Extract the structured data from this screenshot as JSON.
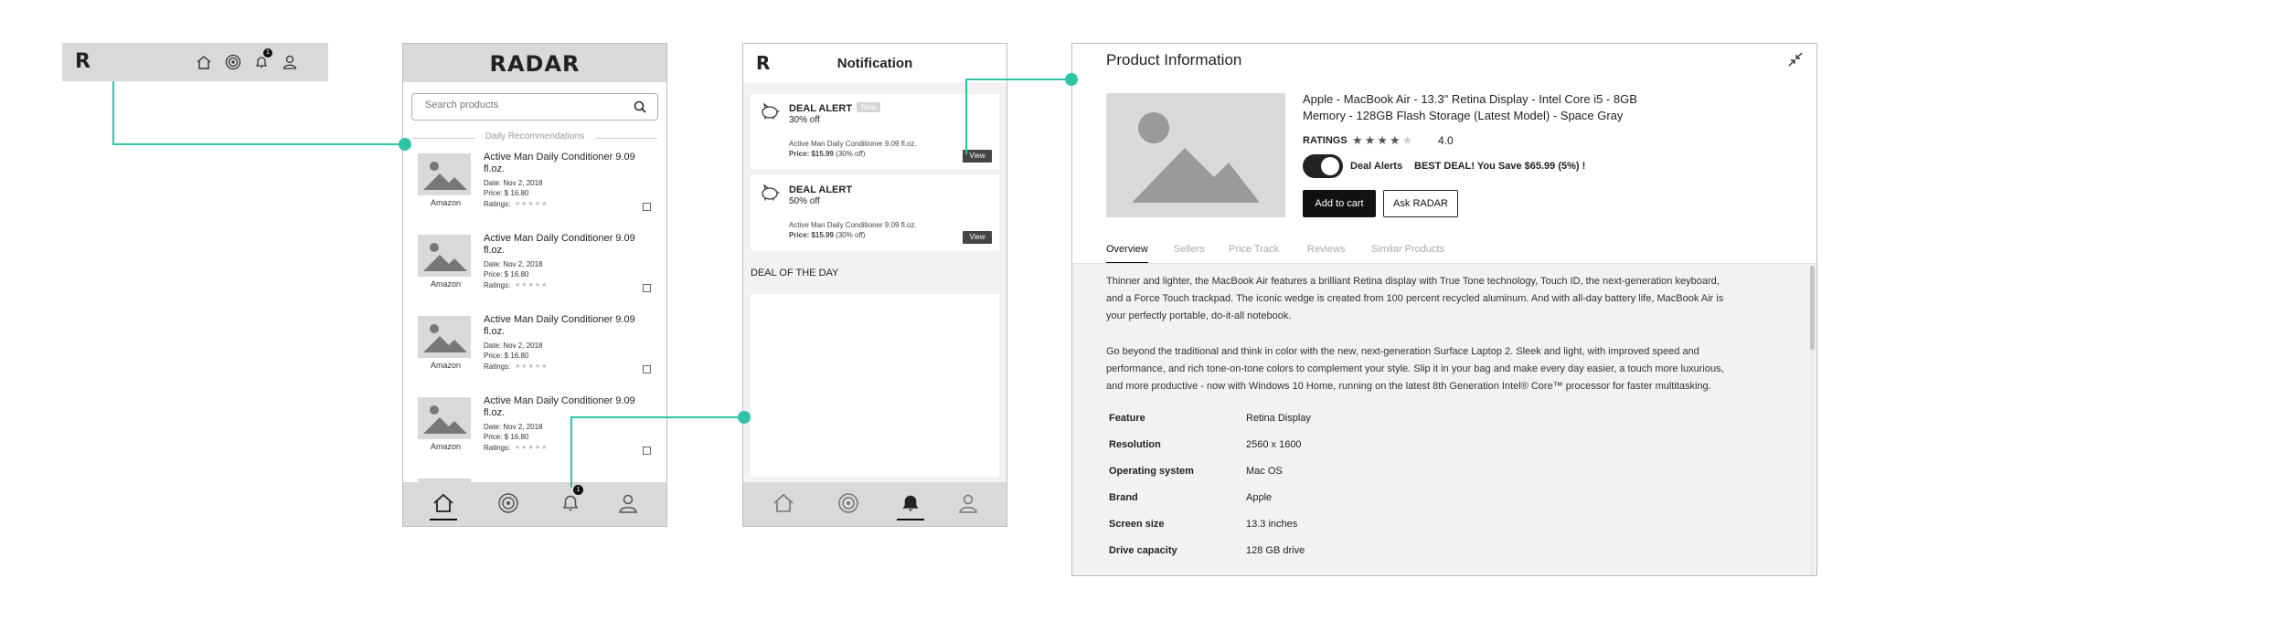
{
  "app": {
    "logo_letter": "R",
    "brand_name": "RADAR",
    "badge_count": "1"
  },
  "home": {
    "search_placeholder": "Search products",
    "section_title": "Daily Recommendations",
    "items": [
      {
        "title": "Active Man Daily Conditioner 9.09 fl.oz.",
        "date": "Date: Nov 2, 2018",
        "price": "Price: $ 16.80",
        "ratings": "Ratings:",
        "store": "Amazon"
      },
      {
        "title": "Active Man Daily Conditioner 9.09 fl.oz.",
        "date": "Date: Nov 2, 2018",
        "price": "Price: $ 16.80",
        "ratings": "Ratings:",
        "store": "Amazon"
      },
      {
        "title": "Active Man Daily Conditioner 9.09 fl.oz.",
        "date": "Date: Nov 2, 2018",
        "price": "Price: $ 16.80",
        "ratings": "Ratings:",
        "store": "Amazon"
      },
      {
        "title": "Active Man Daily Conditioner 9.09 fl.oz.",
        "date": "Date: Nov 2, 2018",
        "price": "Price: $ 16.80",
        "ratings": "Ratings:",
        "store": "Amazon"
      }
    ]
  },
  "notification": {
    "title": "Notification",
    "alerts": [
      {
        "label": "DEAL ALERT",
        "badge": "New",
        "discount": "30% off",
        "product": "Active Man Daily Conditioner 9.09 fl.oz.",
        "price_bold": "Price: $15.99",
        "price_rest": " (30% off)",
        "view": "View"
      },
      {
        "label": "DEAL ALERT",
        "badge": "",
        "discount": "50% off",
        "product": "Active Man Daily Conditioner 9.09 fl.oz.",
        "price_bold": "Price: $15.99",
        "price_rest": " (30% off)",
        "view": "View"
      }
    ],
    "deal_of_day": "DEAL OF THE DAY"
  },
  "product": {
    "header": "Product Information",
    "name_line1": "Apple - MacBook Air - 13.3\" Retina Display - Intel Core i5 - 8GB",
    "name_line2": "Memory - 128GB Flash Storage (Latest Model) - Space Gray",
    "ratings_label": "RATINGS",
    "rating_value": "4.0",
    "rating_stars": 4,
    "deal_alerts_label": "Deal Alerts",
    "best_deal": "BEST DEAL! You Save $65.99 (5%) !",
    "add_to_cart": "Add to cart",
    "ask_radar": "Ask RADAR",
    "tabs": [
      "Overview",
      "Sellers",
      "Price Track",
      "Reviews",
      "Similar Products"
    ],
    "para1": [
      "Thinner and lighter, the MacBook Air features a brilliant Retina display with True Tone technology, Touch ID, the next-generation keyboard,",
      "and a Force Touch trackpad. The iconic wedge is created from 100 percent recycled aluminum. And with all-day battery life, MacBook Air is",
      "your perfectly portable, do-it-all notebook."
    ],
    "para2": [
      "Go beyond the traditional and think in color with the new, next-generation Surface Laptop 2. Sleek and light, with improved speed and",
      "performance, and rich tone-on-tone colors to complement your style. Slip it in your bag and make every day easier, a touch more luxurious,",
      "and more productive - now with Windows 10 Home, running on the latest 8th Generation Intel® Core™ processor for faster multitasking."
    ],
    "specs": [
      {
        "k": "Feature",
        "v": "Retina Display"
      },
      {
        "k": "Resolution",
        "v": "2560 x 1600"
      },
      {
        "k": "Operating system",
        "v": "Mac OS"
      },
      {
        "k": "Brand",
        "v": "Apple"
      },
      {
        "k": "Screen size",
        "v": "13.3 inches"
      },
      {
        "k": "Drive capacity",
        "v": "128 GB drive"
      }
    ]
  },
  "colors": {
    "accent": "#2ec4a6",
    "panel_gray": "#d9d9d9",
    "dark": "#111111"
  }
}
